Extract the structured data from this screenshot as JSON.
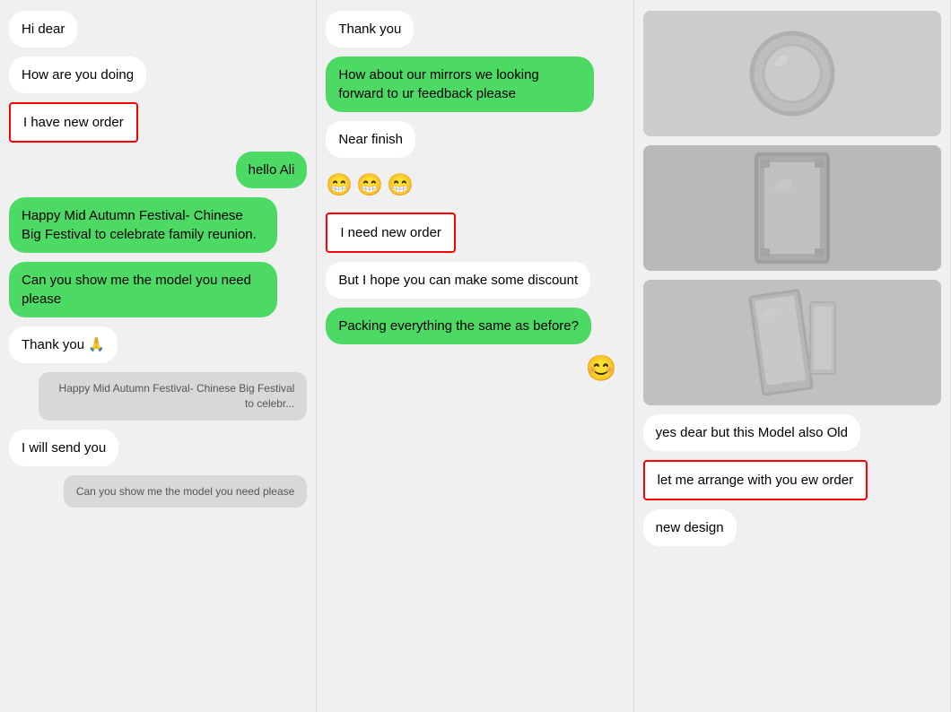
{
  "col1": {
    "messages": [
      {
        "id": "hi-dear",
        "text": "Hi dear",
        "type": "white",
        "align": "left"
      },
      {
        "id": "how-are-you",
        "text": "How are you doing",
        "type": "white",
        "align": "left"
      },
      {
        "id": "have-new-order",
        "text": "I have new order",
        "type": "outlined",
        "align": "left"
      },
      {
        "id": "hello-ali",
        "text": "hello Ali",
        "type": "green",
        "align": "right"
      },
      {
        "id": "mid-autumn",
        "text": "Happy Mid Autumn Festival- Chinese Big Festival to celebrate family reunion.",
        "type": "green",
        "align": "left"
      },
      {
        "id": "show-model",
        "text": "Can you show me the model you need please",
        "type": "green",
        "align": "left"
      },
      {
        "id": "thank-you-pray",
        "text": "Thank you 🙏",
        "type": "white",
        "align": "left"
      },
      {
        "id": "mid-autumn-small",
        "text": "Happy Mid Autumn Festival- Chinese Big Festival to celebr...",
        "type": "gray-small",
        "align": "right"
      },
      {
        "id": "will-send",
        "text": "I will send you",
        "type": "white",
        "align": "left"
      },
      {
        "id": "show-model-small",
        "text": "Can you show me the model you need please",
        "type": "gray-small",
        "align": "right"
      }
    ]
  },
  "col2": {
    "messages": [
      {
        "id": "thank-you",
        "text": "Thank you",
        "type": "white",
        "align": "left"
      },
      {
        "id": "mirrors-feedback",
        "text": "How about our mirrors we looking forward to ur feedback please",
        "type": "green",
        "align": "left"
      },
      {
        "id": "near-finish",
        "text": "Near finish",
        "type": "white",
        "align": "left"
      },
      {
        "id": "emojis",
        "type": "emoji",
        "align": "left",
        "emojis": [
          "😁",
          "😁",
          "😁"
        ]
      },
      {
        "id": "need-new-order",
        "text": "I need new order",
        "type": "outlined",
        "align": "left"
      },
      {
        "id": "discount",
        "text": "But I hope you can make some discount",
        "type": "white",
        "align": "left"
      },
      {
        "id": "packing",
        "text": "Packing everything the same as before?",
        "type": "green",
        "align": "left"
      }
    ],
    "icon": "😊"
  },
  "col3": {
    "images": [
      {
        "id": "img1",
        "shape": "circle"
      },
      {
        "id": "img2",
        "shape": "tall"
      },
      {
        "id": "img3",
        "shape": "lean"
      }
    ],
    "messages": [
      {
        "id": "yes-dear",
        "text": "yes dear but this Model also Old",
        "type": "white",
        "align": "left"
      },
      {
        "id": "arrange-order",
        "text": "let me arrange with you ew order",
        "type": "outlined",
        "align": "left"
      },
      {
        "id": "new-design",
        "text": "new design",
        "type": "white",
        "align": "left"
      }
    ]
  }
}
